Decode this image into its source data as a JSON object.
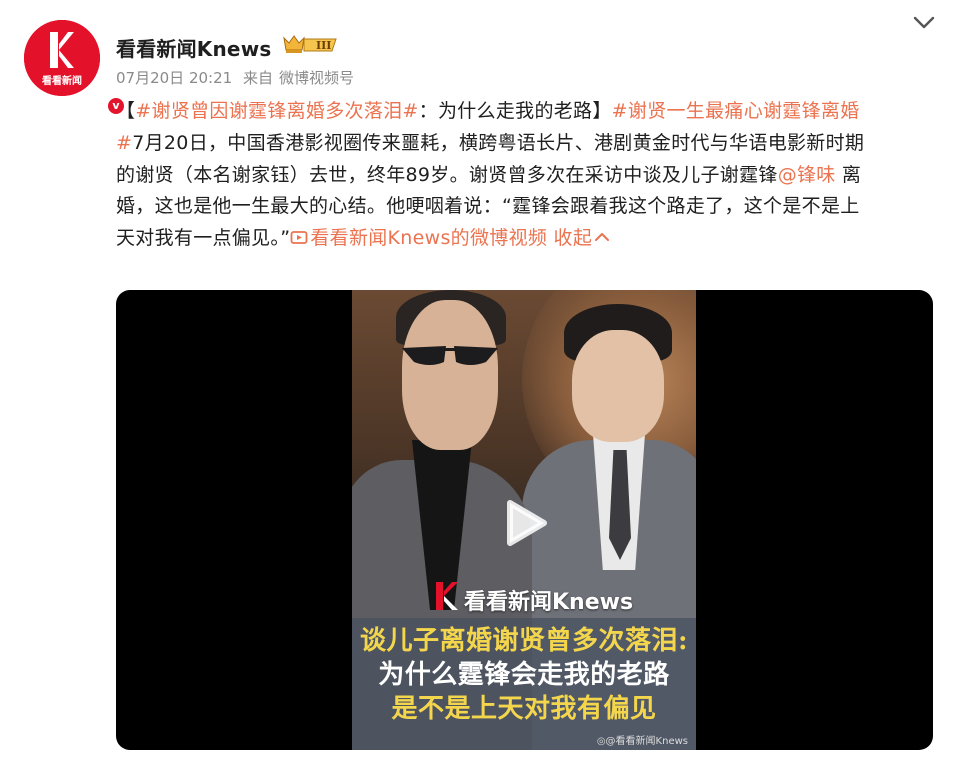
{
  "post": {
    "author": "看看新闻Knews",
    "avatar_text": "看看新闻",
    "verified_mark": "v",
    "vip_level": "III",
    "date": "07月20日 20:21",
    "source_prefix": "来自",
    "source": "微博视频号",
    "collapse_icon": "chevron-down-icon"
  },
  "content": {
    "line1": {
      "bracket_open": "【",
      "tag1": "#谢贤曾因谢霆锋离婚多次落泪#",
      "text": "：为什么走我的老路】",
      "tag2": "#谢贤一生最痛心谢霆锋离婚"
    },
    "line2": {
      "tag_end": "#",
      "text": "7月20日，中国香港影视圈传来噩耗，横跨粤语长片、港剧黄金时代与华语电影新时期"
    },
    "line3": {
      "text": "的谢贤（本名谢家钰）去世，终年89岁。谢贤曾多次在采访中谈及儿子谢霆锋",
      "mention": "@锋味",
      "text_after": " 离"
    },
    "line4": {
      "text": "婚，这也是他一生最大的心结。他哽咽着说：“霆锋会跟着我这个路走了，这个是不是上"
    },
    "line5": {
      "text": "天对我有一点偏见。”",
      "video_link": "看看新闻Knews的微博视频",
      "collapse": "收起",
      "collapse_arrow": "^"
    }
  },
  "video": {
    "logo_text": "看看新闻Knews",
    "caption_line1": "谈儿子离婚谢贤曾多次落泪:",
    "caption_line2": "为什么霆锋会走我的老路",
    "caption_line3": "是不是上天对我有偏见",
    "watermark": "◎@看看新闻Knews",
    "play_icon": "play-icon"
  },
  "colors": {
    "link": "#eb7350",
    "brand_red": "#e3112a",
    "caption_yellow": "#f4d64d"
  }
}
